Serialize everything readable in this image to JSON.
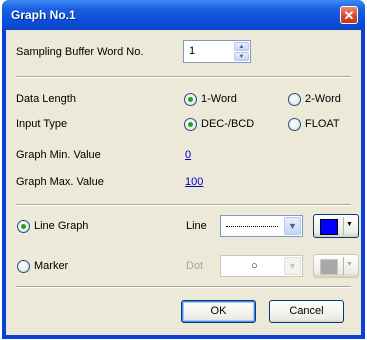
{
  "window": {
    "title": "Graph No.1",
    "close_glyph": "✕"
  },
  "sampling": {
    "label": "Sampling Buffer Word No.",
    "value": "1"
  },
  "data_length": {
    "label": "Data Length",
    "options": [
      "1-Word",
      "2-Word"
    ],
    "selected": "1-Word"
  },
  "input_type": {
    "label": "Input Type",
    "options": [
      "DEC-/BCD",
      "FLOAT"
    ],
    "selected": "DEC-/BCD"
  },
  "graph_min": {
    "label": "Graph Min. Value",
    "value": "0"
  },
  "graph_max": {
    "label": "Graph Max. Value",
    "value": "100"
  },
  "line_graph": {
    "label": "Line Graph",
    "selected": true,
    "style_label": "Line",
    "color": "#0000ff"
  },
  "marker": {
    "label": "Marker",
    "selected": false,
    "style_label": "Dot",
    "symbol": "○",
    "color": "#a8a8a8",
    "enabled": false
  },
  "buttons": {
    "ok": "OK",
    "cancel": "Cancel"
  }
}
